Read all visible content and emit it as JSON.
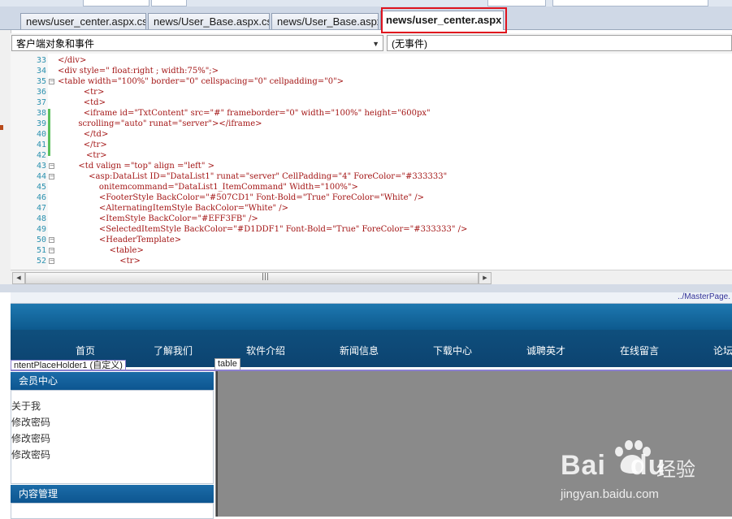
{
  "tabs": [
    {
      "label": "news/user_center.aspx.cs",
      "active": false
    },
    {
      "label": "news/User_Base.aspx.cs",
      "active": false
    },
    {
      "label": "news/User_Base.aspx",
      "active": false
    },
    {
      "label": "news/user_center.aspx",
      "active": true
    }
  ],
  "toolbar": {
    "object_dropdown": "客户端对象和事件",
    "event_dropdown": "(无事件)"
  },
  "code_lines": [
    {
      "n": "33",
      "text": "</div>"
    },
    {
      "n": "34",
      "text": "<div style=\" float:right ; width:75%\";>"
    },
    {
      "n": "35",
      "text": "<table width=\"100%\" border=\"0\" cellspacing=\"0\" cellpadding=\"0\">"
    },
    {
      "n": "36",
      "text": "          <tr>"
    },
    {
      "n": "37",
      "text": "          <td>"
    },
    {
      "n": "38",
      "text": "          <iframe id=\"TxtContent\" src=\"#\" frameborder=\"0\" width=\"100%\" height=\"600px\""
    },
    {
      "n": "39",
      "text": "        scrolling=\"auto\" runat=\"server\"></iframe>"
    },
    {
      "n": "40",
      "text": "          </td>"
    },
    {
      "n": "41",
      "text": "          </tr>"
    },
    {
      "n": "42",
      "text": "           <tr>"
    },
    {
      "n": "43",
      "text": "        <td valign =\"top\" align =\"left\" >"
    },
    {
      "n": "44",
      "text": "            <asp:DataList ID=\"DataList1\" runat=\"server\" CellPadding=\"4\" ForeColor=\"#333333\""
    },
    {
      "n": "45",
      "text": "                onitemcommand=\"DataList1_ItemCommand\" Width=\"100%\">"
    },
    {
      "n": "46",
      "text": "                <FooterStyle BackColor=\"#507CD1\" Font-Bold=\"True\" ForeColor=\"White\" />"
    },
    {
      "n": "47",
      "text": "                <AlternatingItemStyle BackColor=\"White\" />"
    },
    {
      "n": "48",
      "text": "                <ItemStyle BackColor=\"#EFF3FB\" />"
    },
    {
      "n": "49",
      "text": "                <SelectedItemStyle BackColor=\"#D1DDF1\" Font-Bold=\"True\" ForeColor=\"#333333\" />"
    },
    {
      "n": "50",
      "text": "                <HeaderTemplate>"
    },
    {
      "n": "51",
      "text": "                    <table>"
    },
    {
      "n": "52",
      "text": "                        <tr>"
    }
  ],
  "path_label": "../MasterPage.",
  "nav_items": [
    "首页",
    "了解我们",
    "软件介绍",
    "新闻信息",
    "下载中心",
    "诚聘英才",
    "在线留言",
    "论坛"
  ],
  "placeholder_label": "ntentPlaceHolder1 (自定义)",
  "table_label": "table",
  "member_panel": {
    "title": "会员中心",
    "items": [
      "关于我",
      "修改密码",
      "修改密码",
      "修改密码"
    ]
  },
  "content_panel": {
    "title": "内容管理"
  },
  "watermark": {
    "brand": "Bai",
    "brand_suffix": "du",
    "cn": "经验",
    "url": "jingyan.baidu.com"
  }
}
